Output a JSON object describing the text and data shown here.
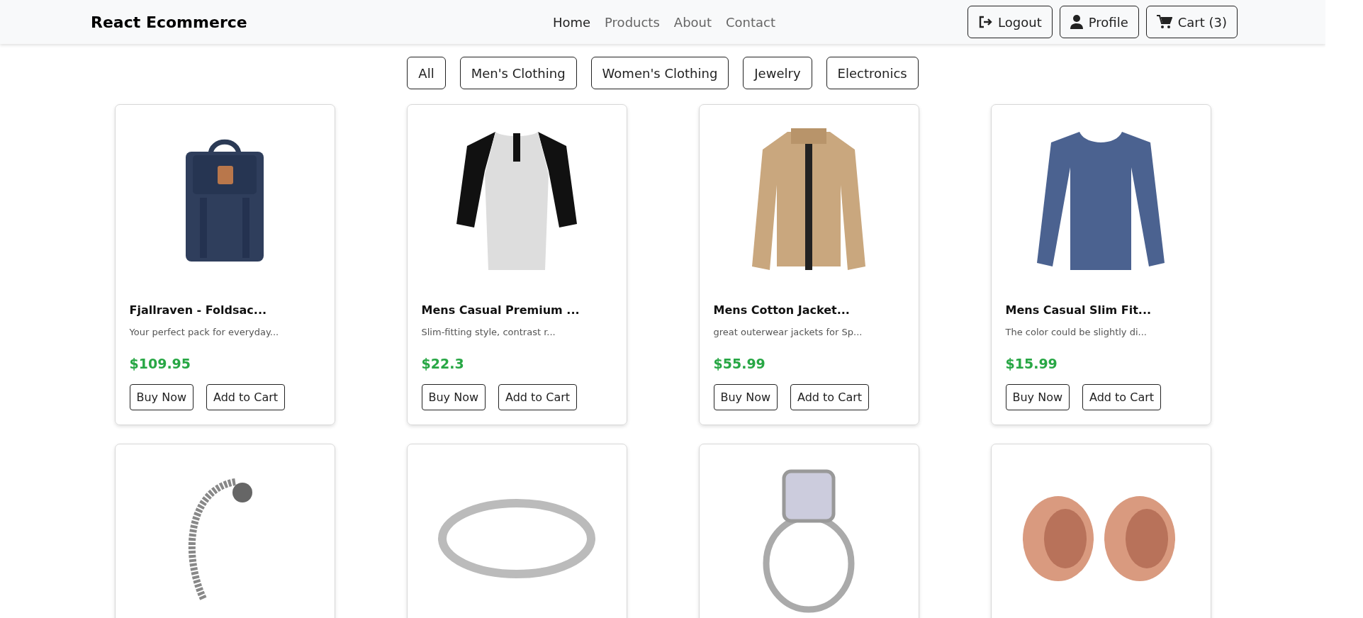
{
  "navbar": {
    "brand": "React Ecommerce",
    "links": [
      {
        "label": "Home",
        "active": true
      },
      {
        "label": "Products",
        "active": false
      },
      {
        "label": "About",
        "active": false
      },
      {
        "label": "Contact",
        "active": false
      }
    ],
    "actions": [
      {
        "kind": "logout",
        "label": "Logout"
      },
      {
        "kind": "profile",
        "label": "Profile"
      },
      {
        "kind": "cart",
        "label": "Cart (3)"
      }
    ]
  },
  "filters": [
    "All",
    "Men's Clothing",
    "Women's Clothing",
    "Jewelry",
    "Electronics"
  ],
  "products": [
    {
      "kind": "backpack",
      "title": "Fjallraven - Foldsac...",
      "description": "Your perfect pack for everyday...",
      "price": "$109.95",
      "buttons": [
        "Buy Now",
        "Add to Cart"
      ]
    },
    {
      "kind": "raglan",
      "title": "Mens Casual Premium ...",
      "description": "Slim-fitting style, contrast r...",
      "price": "$22.3",
      "buttons": [
        "Buy Now",
        "Add to Cart"
      ]
    },
    {
      "kind": "jacket",
      "title": "Mens Cotton Jacket...",
      "description": "great outerwear jackets for Sp...",
      "price": "$55.99",
      "buttons": [
        "Buy Now",
        "Add to Cart"
      ]
    },
    {
      "kind": "sweater",
      "title": "Mens Casual Slim Fit...",
      "description": "The color could be slightly di...",
      "price": "$15.99",
      "buttons": [
        "Buy Now",
        "Add to Cart"
      ]
    },
    {
      "kind": "bracelet"
    },
    {
      "kind": "ring"
    },
    {
      "kind": "ringset"
    },
    {
      "kind": "plugs"
    }
  ]
}
